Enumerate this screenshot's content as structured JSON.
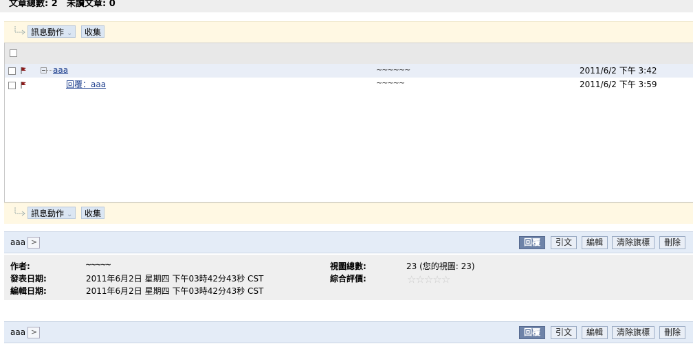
{
  "stats": {
    "total_label": "文章總數: 2",
    "unread_label": "未讀文章: 0"
  },
  "toolbar": {
    "actions_label": "訊息動作",
    "collect_label": "收集"
  },
  "list": {
    "rows": [
      {
        "subject": "aaa",
        "author": "~~~~~~",
        "date": "2011/6/2 下午 3:42"
      },
      {
        "subject": "回覆：aaa",
        "author": "~~~~~",
        "date": "2011/6/2 下午 3:59"
      }
    ]
  },
  "message": {
    "title": "aaa",
    "buttons": {
      "reply": "回覆",
      "quote": "引文",
      "edit": "編輯",
      "clear_flag": "清除旗標",
      "delete": "刪除"
    },
    "details": {
      "author_label": "作者:",
      "author_value": "~~~~~",
      "posted_label": "發表日期:",
      "posted_value": "2011年6月2日 星期四 下午03時42分43秒 CST",
      "edited_label": "編輯日期:",
      "edited_value": "2011年6月2日 星期四 下午03時42分43秒 CST",
      "views_label": "視圖總數:",
      "views_value": "23 (您的視圖: 23)",
      "rating_label": "綜合評價:"
    }
  },
  "icons": {
    "flag": "flag-icon",
    "expand": "tree-collapse-icon",
    "star": "star-icon",
    "nav": "chevron-right-icon",
    "arrow": "elbow-arrow-icon",
    "dropdown": "double-chevron-down-icon"
  },
  "colors": {
    "flag": "#8b1a1a",
    "primary_button": "#6e83a8",
    "link": "#1a3c8c"
  }
}
